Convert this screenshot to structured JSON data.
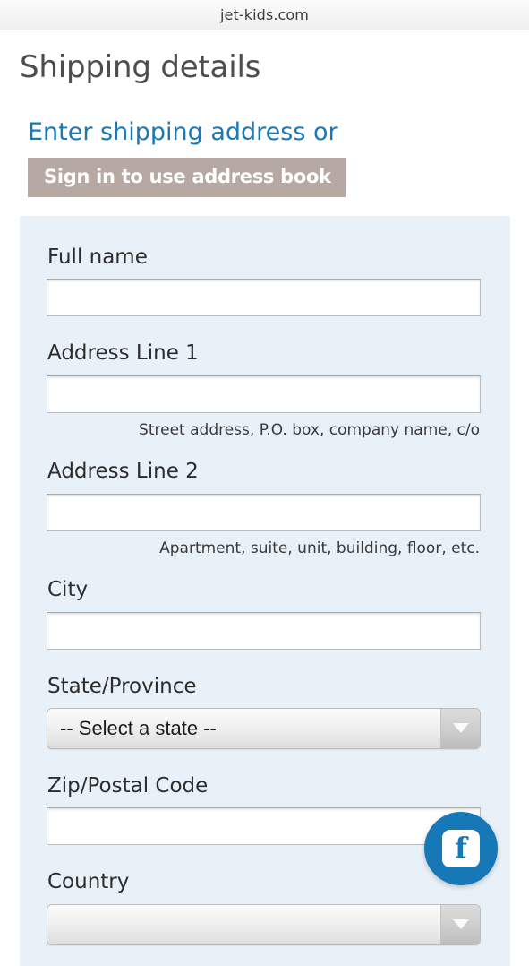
{
  "browser": {
    "url": "jet-kids.com"
  },
  "page": {
    "title": "Shipping details",
    "address_heading": "Enter shipping address or",
    "signin_button": "Sign in to use address book"
  },
  "form": {
    "fields": [
      {
        "label": "Full name",
        "type": "text",
        "value": "",
        "placeholder": "",
        "hint": ""
      },
      {
        "label": "Address Line 1",
        "type": "text",
        "value": "",
        "placeholder": "",
        "hint": "Street address, P.O. box, company name, c/o"
      },
      {
        "label": "Address Line 2",
        "type": "text",
        "value": "",
        "placeholder": "",
        "hint": "Apartment, suite, unit, building, floor, etc."
      },
      {
        "label": "City",
        "type": "text",
        "value": "",
        "placeholder": "",
        "hint": ""
      },
      {
        "label": "State/Province",
        "type": "select",
        "value": "-- Select a state --",
        "hint": ""
      },
      {
        "label": "Zip/Postal Code",
        "type": "text",
        "value": "",
        "placeholder": "",
        "hint": ""
      },
      {
        "label": "Country",
        "type": "select",
        "value": "",
        "hint": ""
      }
    ]
  },
  "floating": {
    "facebook_icon": "facebook-icon",
    "facebook_glyph": "f"
  },
  "colors": {
    "accent_blue": "#1a78b8",
    "panel_bg": "#e9f1f8",
    "button_taupe": "#b6a9a4",
    "title_gray": "#4d4d4d",
    "facebook_blue": "#1778b8"
  }
}
